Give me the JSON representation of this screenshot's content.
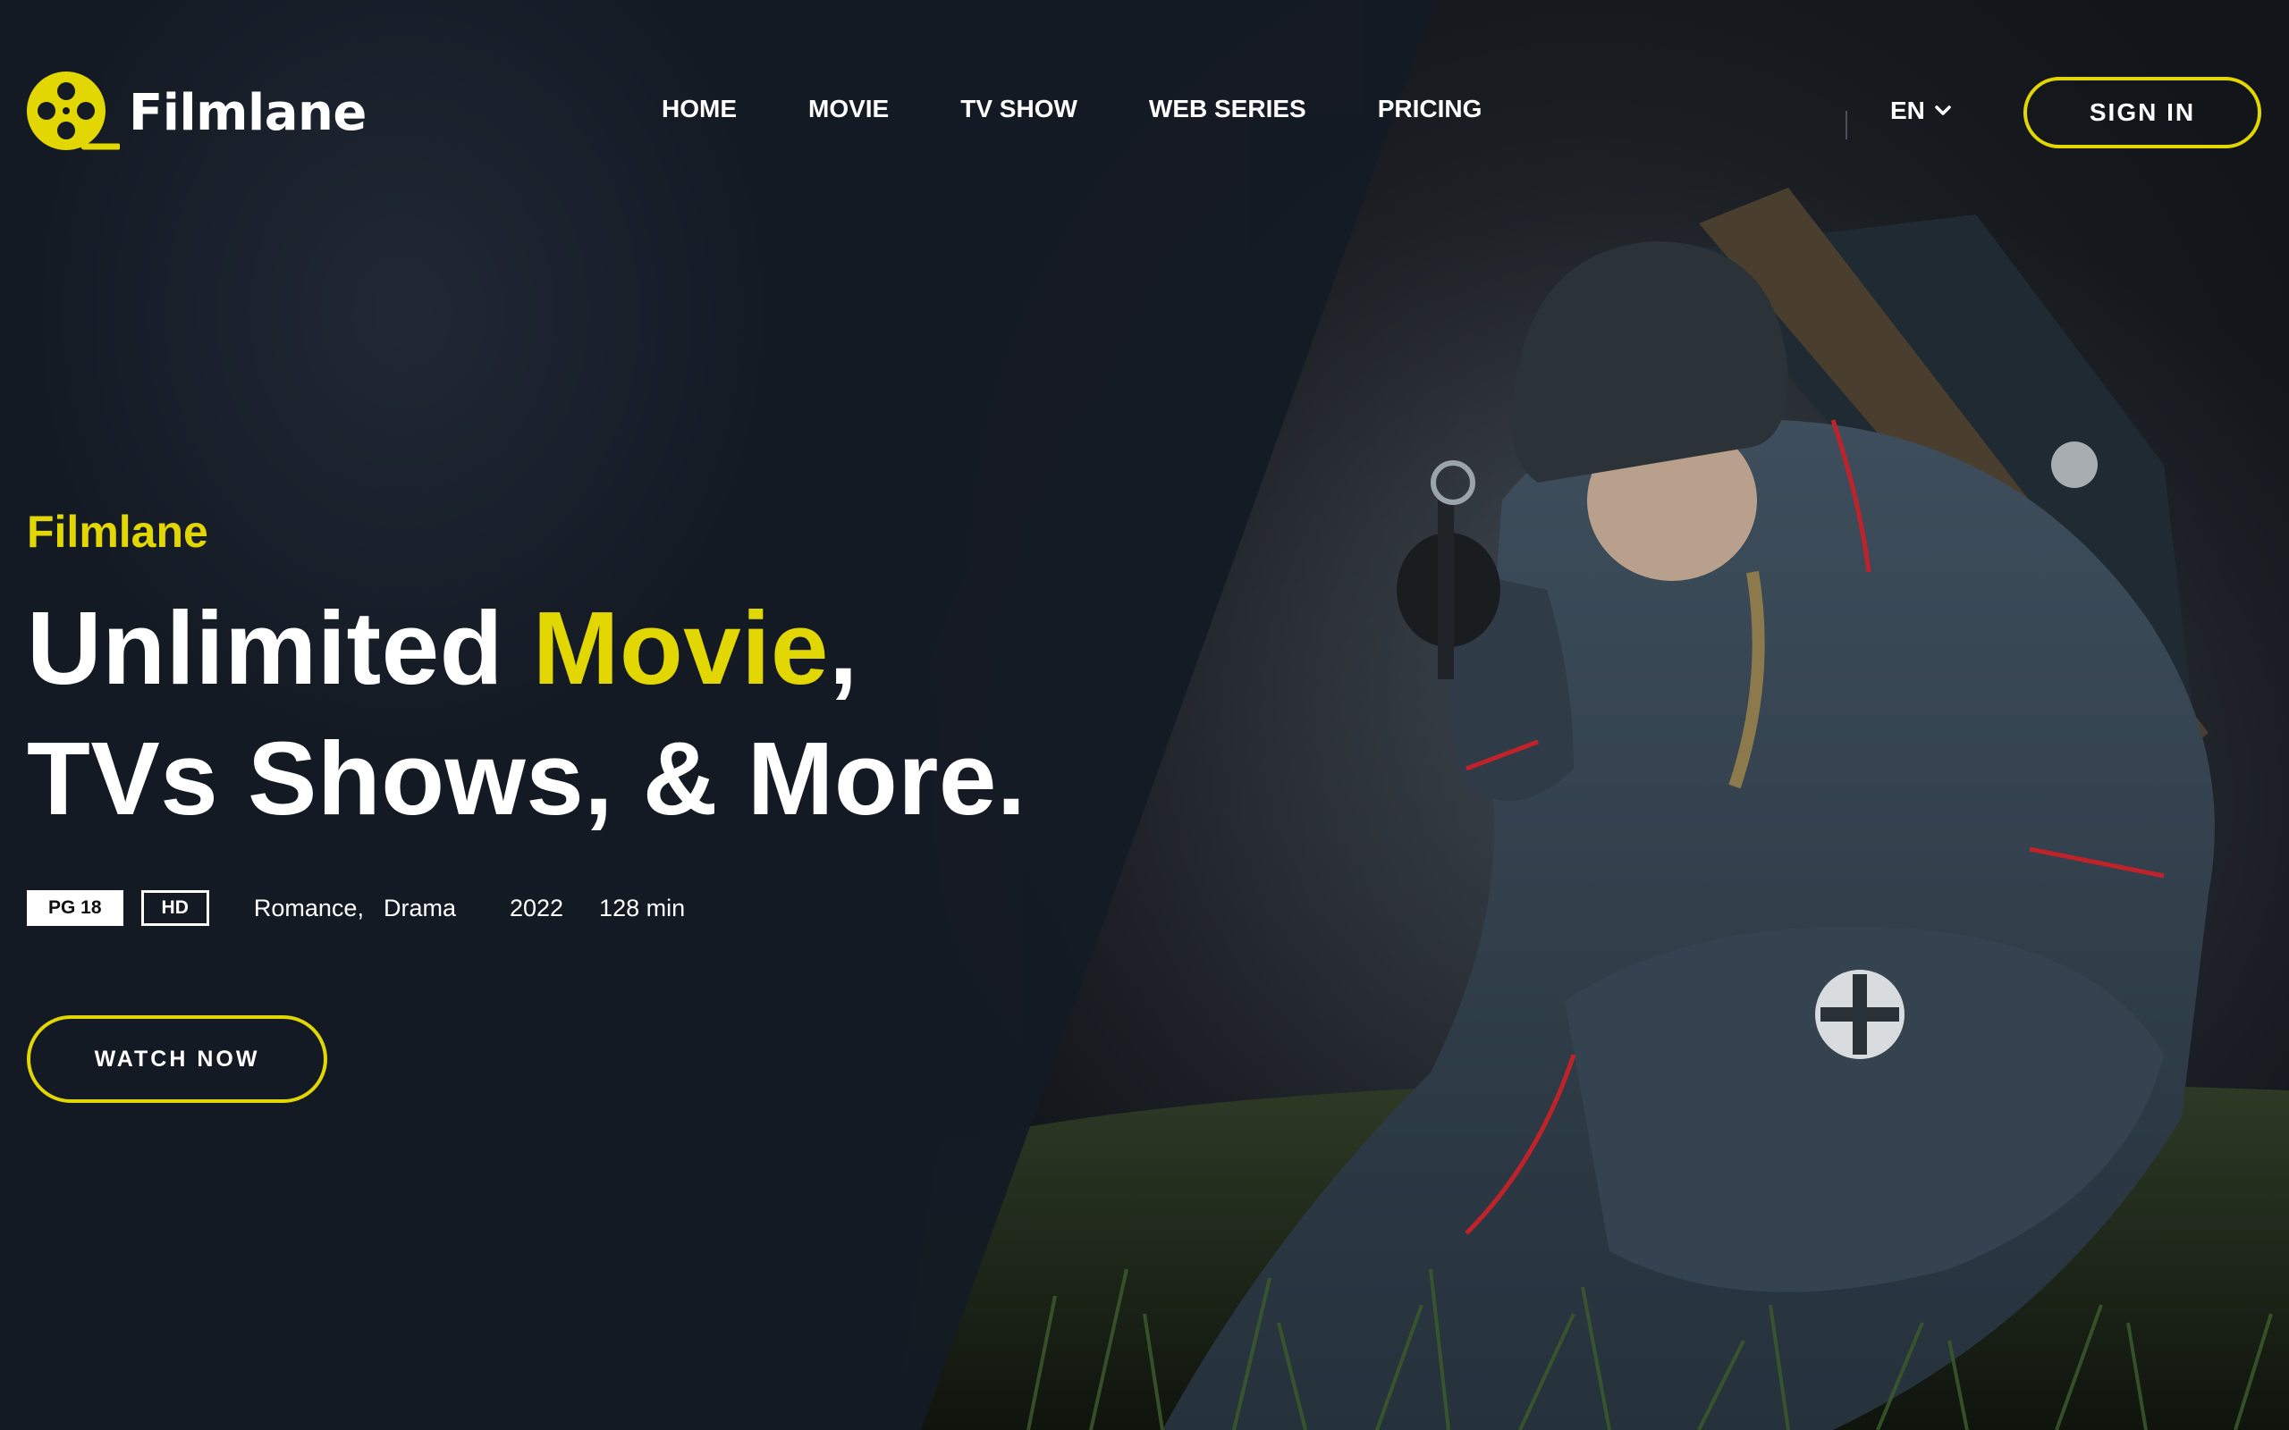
{
  "brand": {
    "name": "Filmlane",
    "logo_icon": "film-reel-icon",
    "accent_color": "#e2d703"
  },
  "nav": {
    "items": [
      {
        "label": "HOME"
      },
      {
        "label": "MOVIE"
      },
      {
        "label": "TV SHOW"
      },
      {
        "label": "WEB SERIES"
      },
      {
        "label": "PRICING"
      }
    ],
    "language": {
      "selected": "EN",
      "icon": "chevron-down-icon"
    },
    "sign_in_label": "SIGN IN"
  },
  "hero": {
    "subtitle": "Filmlane",
    "title_part1": "Unlimited ",
    "title_accent": "Movie",
    "title_part2": ",",
    "title_line2": "TVs Shows, & More.",
    "badges": {
      "rating": "PG 18",
      "quality": "HD"
    },
    "genres": [
      "Romance,",
      "Drama"
    ],
    "year": "2022",
    "runtime": "128 min",
    "cta_label": "WATCH NOW"
  }
}
